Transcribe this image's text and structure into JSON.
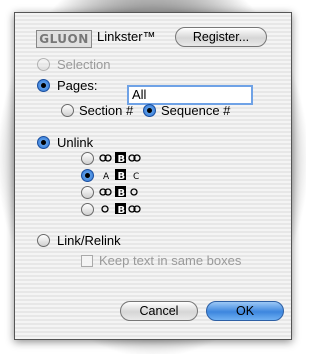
{
  "header": {
    "logo_text": "GLUON",
    "app_name": "Linkster™",
    "register_label": "Register..."
  },
  "range": {
    "selection_label": "Selection",
    "pages_label": "Pages:",
    "pages_value": "All",
    "section_label": "Section #",
    "sequence_label": "Sequence #"
  },
  "mode": {
    "unlink_label": "Unlink",
    "unlink_options": [
      {
        "name": "link-chain-both",
        "selected": false
      },
      {
        "name": "separate-text-boxes-abc",
        "selected": true
      },
      {
        "name": "link-chain-left",
        "selected": false
      },
      {
        "name": "link-chain-right",
        "selected": false
      }
    ],
    "link_relink_label": "Link/Relink",
    "keep_text_label": "Keep text in same boxes"
  },
  "buttons": {
    "cancel_label": "Cancel",
    "ok_label": "OK"
  },
  "colors": {
    "accent": "#2a6fd3",
    "disabled_text": "#9a9a9a"
  }
}
